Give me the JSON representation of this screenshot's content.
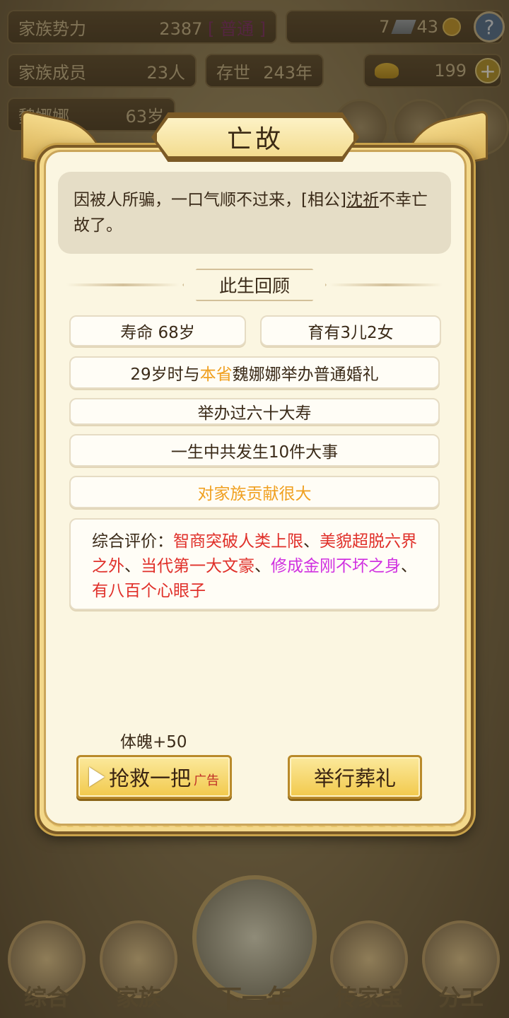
{
  "header": {
    "power_label": "家族势力",
    "power_value": "2387",
    "power_rank": "[ 普通 ]",
    "resource_tiles": "7",
    "resource_coins": "43",
    "members_label": "家族成员",
    "members_value": "23人",
    "existence_label": "存世",
    "existence_value": "243年",
    "gold_value": "199",
    "person_name": "魏娜娜",
    "person_age": "63岁"
  },
  "dialog": {
    "title": "亡故",
    "message_part1": "因被人所骗，一口气顺不过来，[相公]",
    "message_name": "沈祈",
    "message_part2": "不幸亡故了。",
    "section_title": "此生回顾",
    "lifespan": "寿命 68岁",
    "children": "育有3儿2女",
    "marriage_part1": "29岁时与",
    "marriage_highlight": "本省",
    "marriage_part2": "魏娜娜举办普通婚礼",
    "birthday": "举办过六十大寿",
    "events": "一生中共发生10件大事",
    "contribution": "对家族贡献很大",
    "eval_label": "综合评价：",
    "eval_trait1": "智商突破人类上限",
    "eval_sep1": "、",
    "eval_trait2": "美貌超脱六界之外",
    "eval_sep2": "、",
    "eval_trait3": "当代第一大文豪",
    "eval_sep3": "、",
    "eval_trait4": "修成金刚不坏之身",
    "eval_sep4": "、",
    "eval_trait5": "有八百个心眼子",
    "reward": "体魄+50",
    "rescue_label": "抢救一把",
    "ad_tag": "广告",
    "funeral_label": "举行葬礼"
  },
  "nav": {
    "overview": "综合",
    "family": "家族",
    "next_year": "下一年",
    "heirloom": "传家宝",
    "division": "分工"
  },
  "colors": {
    "highlight_orange": "#f0a020",
    "highlight_red": "#e0302a",
    "highlight_purple": "#d030e0",
    "button_gold": "#f2c94c"
  },
  "icons": [
    "help-icon",
    "tile-icon",
    "coin-icon",
    "gold-ingot-icon",
    "plus-icon",
    "play-icon"
  ]
}
